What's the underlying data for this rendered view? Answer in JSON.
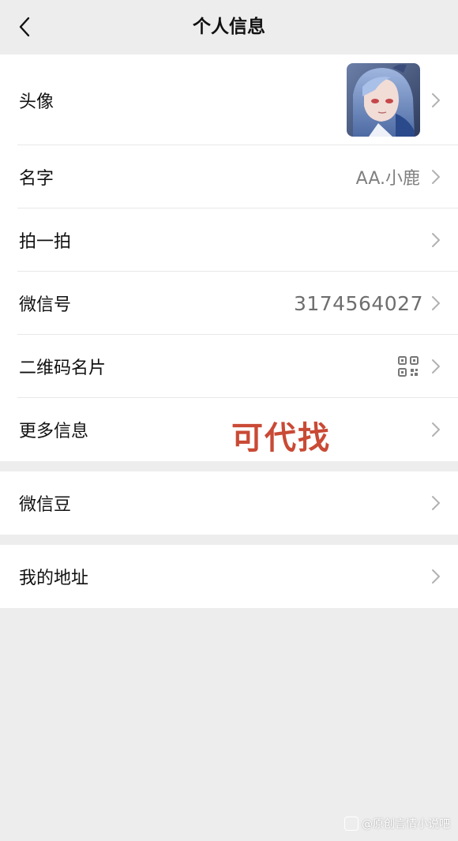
{
  "header": {
    "title": "个人信息"
  },
  "groups": [
    {
      "rows": [
        {
          "label": "头像"
        },
        {
          "label": "名字",
          "value": "AA.小鹿"
        },
        {
          "label": "拍一拍"
        },
        {
          "label": "微信号",
          "value": "3174564027"
        },
        {
          "label": "二维码名片"
        },
        {
          "label": "更多信息"
        }
      ]
    },
    {
      "rows": [
        {
          "label": "微信豆"
        }
      ]
    },
    {
      "rows": [
        {
          "label": "我的地址"
        }
      ]
    }
  ],
  "overlay_text": "可代找",
  "watermark": "@原创言情小说吧",
  "icons": {
    "back": "back-chevron-icon",
    "row_arrow": "chevron-right-icon",
    "qr": "qr-code-icon",
    "avatar": "anime-avatar-image"
  },
  "colors": {
    "page_bg": "#ededed",
    "card_bg": "#ffffff",
    "overlay": "#c94a35",
    "secondary_text": "#808080"
  }
}
